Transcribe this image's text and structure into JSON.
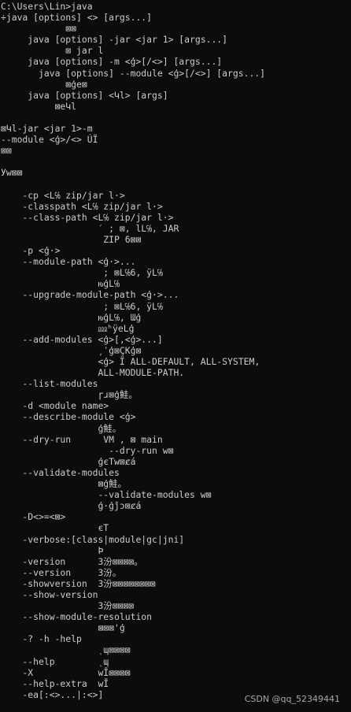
{
  "console": {
    "lines": [
      "C:\\Users\\Lin>java",
      "÷java [options] <> [args...]",
      "            ⊠⊠",
      "     java [options] -jar <jar 1> [args...]",
      "            ⊠ jar l",
      "     java [options] -m <ģ>[/<>] [args...]",
      "       java [options] --module <ģ>[/<>] [args...]",
      "            ⊠ģe⊠",
      "     java [options] <Կl> [args]",
      "          ⊠eԿl",
      "",
      "⊠Կl-jar <jar 1>-m",
      "--module <ģ>/<> ÚЇ",
      "⊠⊠",
      "",
      "Уw⊠⊠",
      "",
      "    -cp <L℅ zip/jar l·>",
      "    -classpath <L℅ zip/jar l·>",
      "    --class-path <L℅ zip/jar l·>",
      "                  ′ ; ⊠, lL℅, JAR",
      "                   ZIP 6⊠⊠",
      "    -p <ģ·>",
      "    --module-path <ģ·>...",
      "                   ; ⊠L℅6, ÿL℅",
      "                  ԋģL℅",
      "    --upgrade-module-path <ģ·>...",
      "                   ; ⊠L℅6, ÿL℅",
      "                  ԋģL℅, Ɯģ",
      "                  ⅏ʰÿeLģ",
      "    --add-modules <ģ>[,<ģ>...]",
      "                  ͵ʾģ⊠ÇKģ⊠",
      "                  <ģ> Ï ALL-DEFAULT, ALL-SYSTEM,",
      "                  ALL-MODULE-PATH.",
      "    --list-modules",
      "                  ɼɹ⊠ģ鮭。",
      "    -d <module name>",
      "    --describe-module <ģ>",
      "                  ģ鮭。",
      "    --dry-run      VM , ⊠ main",
      "                    --dry-run w⊠",
      "                  ģєTw⊠ȼá",
      "    --validate-modules",
      "                  ⊠ģ鮭。",
      "                  --validate-modules w⊠",
      "                  ģ·ģĵͻ⊠ȼá",
      "    -D<>=<⊠>",
      "                  єT",
      "    -verbose:[class|module|gc|jni]",
      "                  Ϸ",
      "    -version      3汾⊠⊠⊠⊠。",
      "    --version     3汾。",
      "    -showversion  3汾⊠⊠⊠⊠⊠⊠⊠⊠",
      "    --show-version",
      "                  3汾⊠⊠⊠⊠",
      "    --show-module-resolution",
      "                  ⊠⊠⊠'ģ",
      "    -? -h -help",
      "                  ͺɰ⊠⊠⊠⊠",
      "    --help        ͺɰ",
      "    -X            wĪ⊠⊠⊠⊠",
      "    --help-extra  wĪ",
      "    -ea[:<>...|:<>]"
    ]
  },
  "watermark": {
    "text": "CSDN @qq_52349441"
  }
}
